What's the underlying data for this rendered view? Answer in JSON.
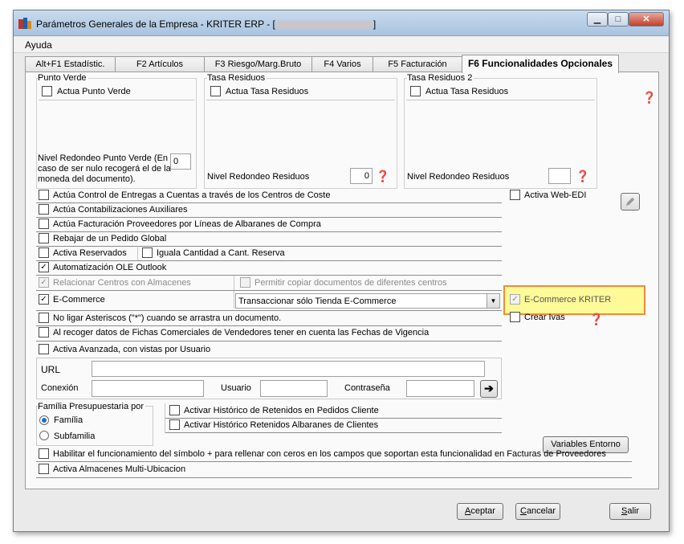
{
  "window": {
    "title_prefix": "Parámetros Generales de la Empresa - KRITER ERP - [",
    "title_suffix": "]",
    "controls": {
      "minimize": "▁",
      "maximize": "□",
      "close": "✕"
    }
  },
  "menu": {
    "ayuda": "Ayuda"
  },
  "tabs": [
    {
      "label": "Alt+F1 Estadístic."
    },
    {
      "label": "F2 Artículos"
    },
    {
      "label": "F3 Riesgo/Marg.Bruto"
    },
    {
      "label": "F4 Varios"
    },
    {
      "label": "F5 Facturación"
    },
    {
      "label": "F6 Funcionalidades Opcionales"
    }
  ],
  "punto_verde": {
    "title": "Punto Verde",
    "checkbox_label": "Actua Punto Verde",
    "nivel_label": "Nivel Redondeo Punto Verde (En caso de ser nulo recogerá el de la moneda del documento).",
    "nivel_value": "0"
  },
  "tasa_residuos": {
    "title": "Tasa Residuos",
    "checkbox_label": "Actua Tasa Residuos",
    "nivel_label": "Nivel Redondeo Residuos",
    "nivel_value": "0"
  },
  "tasa_residuos_2": {
    "title": "Tasa Residuos 2",
    "checkbox_label": "Actua Tasa Residuos",
    "nivel_label": "Nivel Redondeo Residuos",
    "nivel_value": ""
  },
  "options": {
    "control_entregas": {
      "label": "Actúa Control de Entregas a Cuentas a través de los Centros de Coste",
      "checked": false
    },
    "contabilizaciones": {
      "label": "Actúa Contabilizaciones Auxiliares",
      "checked": false
    },
    "facturacion_proveedores": {
      "label": "Actúa Facturación Proveedores por Líneas de Albaranes de Compra",
      "checked": false
    },
    "rebajar_pedido": {
      "label": "Rebajar de un Pedido Global",
      "checked": false
    },
    "activa_reservados": {
      "label": "Activa Reservados",
      "checked": false
    },
    "iguala_cantidad": {
      "label": "Iguala Cantidad a Cant. Reserva",
      "checked": false
    },
    "automatizacion_ole": {
      "label": "Automatización OLE Outlook",
      "checked": true
    },
    "relacionar_centros": {
      "label": "Relacionar Centros con Almacenes",
      "checked": true
    },
    "permitir_copiar": {
      "label": "Permitir copiar documentos de diferentes centros",
      "checked": false
    },
    "ecommerce": {
      "label": "E-Commerce",
      "checked": true
    },
    "no_ligar_asteriscos": {
      "label": "No ligar Asteriscos (\"*\") cuando se arrastra un documento.",
      "checked": false
    },
    "al_recoger_datos": {
      "label": "Al recoger datos de Fichas Comerciales de Vendedores tener en cuenta las Fechas de Vigencia",
      "checked": false
    },
    "activa_avanzada": {
      "label": "Activa Avanzada, con vistas por Usuario",
      "checked": false
    },
    "activa_web_edi": {
      "label": "Activa Web-EDI",
      "checked": false
    },
    "ecommerce_kriter": {
      "label": "E-Commerce KRITER",
      "checked": true
    },
    "crear_ivas": {
      "label": "Crear Ivas",
      "checked": false
    },
    "historico_pedidos": {
      "label": "Activar Histórico de Retenidos en Pedidos Cliente",
      "checked": false
    },
    "historico_albaranes": {
      "label": "Activar Histórico Retenidos Albaranes de Clientes",
      "checked": false
    },
    "habilitar_simbolo": {
      "label": "Habilitar el funcionamiento del símbolo + para rellenar con ceros en los campos que soportan esta funcionalidad en Facturas de Proveedores",
      "checked": false
    },
    "almacenes_multi": {
      "label": "Activa Almacenes Multi-Ubicacion",
      "checked": false
    }
  },
  "ecommerce_combo": {
    "value": "Transaccionar sólo Tienda E-Commerce"
  },
  "connection": {
    "url_label": "URL",
    "url_value": "",
    "conexion_label": "Conexión",
    "conexion_value": "",
    "usuario_label": "Usuario",
    "usuario_value": "",
    "contrasena_label": "Contraseña",
    "contrasena_value": ""
  },
  "familia": {
    "title": "Família Presupuestaria por",
    "familia_label": "Família",
    "subfamilia_label": "Subfamilia",
    "selected": "Família"
  },
  "buttons": {
    "variables_entorno": "Variables Entorno",
    "aceptar_u": "A",
    "aceptar_rest": "ceptar",
    "cancelar_u": "C",
    "cancelar_rest": "ancelar",
    "salir_u": "S",
    "salir_rest": "alir"
  },
  "colors": {
    "highlight_border": "#f08a3a",
    "highlight_fill": "#fdfa98",
    "help_icon": "#c00000"
  },
  "icons": [
    "kriter-app-icon",
    "help-icon",
    "edit-pencil-icon",
    "arrow-right-icon"
  ]
}
